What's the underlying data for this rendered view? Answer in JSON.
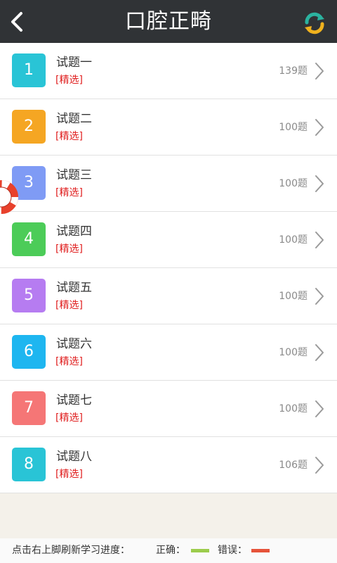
{
  "header": {
    "title": "口腔正畸",
    "back_icon": "chevron-left-icon",
    "refresh_icon": "refresh-icon"
  },
  "colors": {
    "header_bg": "#303336",
    "tag_red": "#e02020",
    "badges": [
      "#29c4d6",
      "#f5a623",
      "#7f9bf5",
      "#4ccc58",
      "#b67cf1",
      "#1eb6f0",
      "#f57676",
      "#29c4d6"
    ]
  },
  "items": [
    {
      "number": "1",
      "title": "试题一",
      "tag": "[精选]",
      "count": "139题"
    },
    {
      "number": "2",
      "title": "试题二",
      "tag": "[精选]",
      "count": "100题"
    },
    {
      "number": "3",
      "title": "试题三",
      "tag": "[精选]",
      "count": "100题"
    },
    {
      "number": "4",
      "title": "试题四",
      "tag": "[精选]",
      "count": "100题"
    },
    {
      "number": "5",
      "title": "试题五",
      "tag": "[精选]",
      "count": "100题"
    },
    {
      "number": "6",
      "title": "试题六",
      "tag": "[精选]",
      "count": "100题"
    },
    {
      "number": "7",
      "title": "试题七",
      "tag": "[精选]",
      "count": "100题"
    },
    {
      "number": "8",
      "title": "试题八",
      "tag": "[精选]",
      "count": "106题"
    }
  ],
  "footer": {
    "hint": "点击右上脚刷新学习进度：",
    "correct_label": "正确：",
    "wrong_label": "错误："
  }
}
